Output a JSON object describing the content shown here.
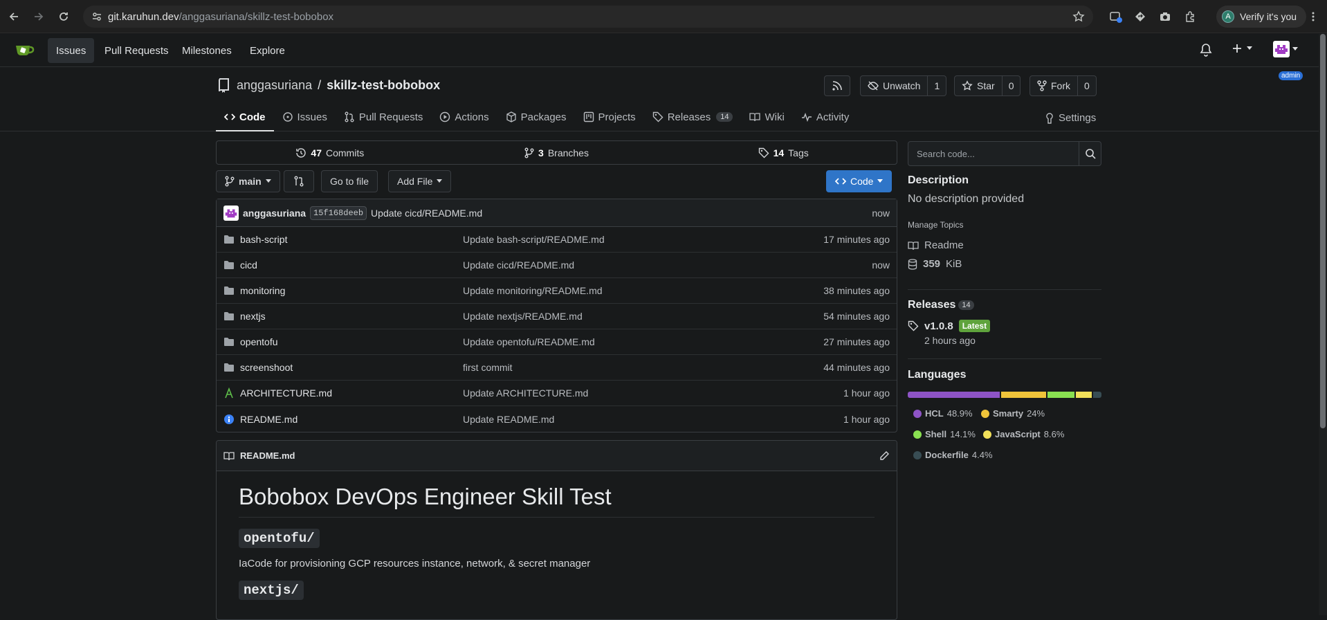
{
  "browser": {
    "url_host": "git.karuhun.dev",
    "url_path": "/anggasuriana/skillz-test-bobobox",
    "profile_initial": "A",
    "profile_label": "Verify it's you"
  },
  "topnav": {
    "items": [
      "Issues",
      "Pull Requests",
      "Milestones",
      "Explore"
    ],
    "active": "Issues",
    "user_badge": "admin"
  },
  "repo": {
    "owner": "anggasuriana",
    "separator": "/",
    "name": "skillz-test-bobobox",
    "unwatch_label": "Unwatch",
    "watch_count": "1",
    "star_label": "Star",
    "star_count": "0",
    "fork_label": "Fork",
    "fork_count": "0"
  },
  "tabs": [
    {
      "label": "Code",
      "icon": "code-icon",
      "active": true
    },
    {
      "label": "Issues",
      "icon": "issue-icon"
    },
    {
      "label": "Pull Requests",
      "icon": "pull-request-icon"
    },
    {
      "label": "Actions",
      "icon": "play-icon"
    },
    {
      "label": "Packages",
      "icon": "package-icon"
    },
    {
      "label": "Projects",
      "icon": "project-icon"
    },
    {
      "label": "Releases",
      "icon": "tag-icon",
      "count": "14"
    },
    {
      "label": "Wiki",
      "icon": "book-icon"
    },
    {
      "label": "Activity",
      "icon": "pulse-icon"
    }
  ],
  "settings_label": "Settings",
  "stats": {
    "commits_num": "47",
    "commits_label": "Commits",
    "branches_num": "3",
    "branches_label": "Branches",
    "tags_num": "14",
    "tags_label": "Tags"
  },
  "toolbar": {
    "branch": "main",
    "goto_file": "Go to file",
    "add_file": "Add File",
    "code": "Code"
  },
  "latest_commit": {
    "author": "anggasuriana",
    "sha": "15f168deeb",
    "message": "Update cicd/README.md",
    "when": "now"
  },
  "files": [
    {
      "name": "bash-script",
      "type": "folder",
      "message": "Update bash-script/README.md",
      "when": "17 minutes ago"
    },
    {
      "name": "cicd",
      "type": "folder",
      "message": "Update cicd/README.md",
      "when": "now"
    },
    {
      "name": "monitoring",
      "type": "folder",
      "message": "Update monitoring/README.md",
      "when": "38 minutes ago"
    },
    {
      "name": "nextjs",
      "type": "folder",
      "message": "Update nextjs/README.md",
      "when": "54 minutes ago"
    },
    {
      "name": "opentofu",
      "type": "folder",
      "message": "Update opentofu/README.md",
      "when": "27 minutes ago"
    },
    {
      "name": "screenshoot",
      "type": "folder",
      "message": "first commit",
      "when": "44 minutes ago"
    },
    {
      "name": "ARCHITECTURE.md",
      "type": "special",
      "message": "Update ARCHITECTURE.md",
      "when": "1 hour ago"
    },
    {
      "name": "README.md",
      "type": "info",
      "message": "Update README.md",
      "when": "1 hour ago"
    }
  ],
  "readme": {
    "filename": "README.md",
    "title": "Bobobox DevOps Engineer Skill Test",
    "section1": "opentofu/",
    "section1_text": "IaCode for provisioning GCP resources instance, network, & secret manager",
    "section2": "nextjs/"
  },
  "sidebar": {
    "search_placeholder": "Search code...",
    "description_heading": "Description",
    "description": "No description provided",
    "manage_topics": "Manage Topics",
    "readme_link": "Readme",
    "size_num": "359",
    "size_unit": "KiB",
    "releases_heading": "Releases",
    "releases_count": "14",
    "release_version": "v1.0.8",
    "release_badge": "Latest",
    "release_when": "2 hours ago",
    "languages_heading": "Languages",
    "languages": [
      {
        "name": "HCL",
        "pct": "48.9%",
        "share": 48.9,
        "color": "#8e54c6"
      },
      {
        "name": "Smarty",
        "pct": "24%",
        "share": 24,
        "color": "#f0c43a"
      },
      {
        "name": "Shell",
        "pct": "14.1%",
        "share": 14.1,
        "color": "#89e051"
      },
      {
        "name": "JavaScript",
        "pct": "8.6%",
        "share": 8.6,
        "color": "#f1e05a"
      },
      {
        "name": "Dockerfile",
        "pct": "4.4%",
        "share": 4.4,
        "color": "#384d54"
      }
    ]
  }
}
